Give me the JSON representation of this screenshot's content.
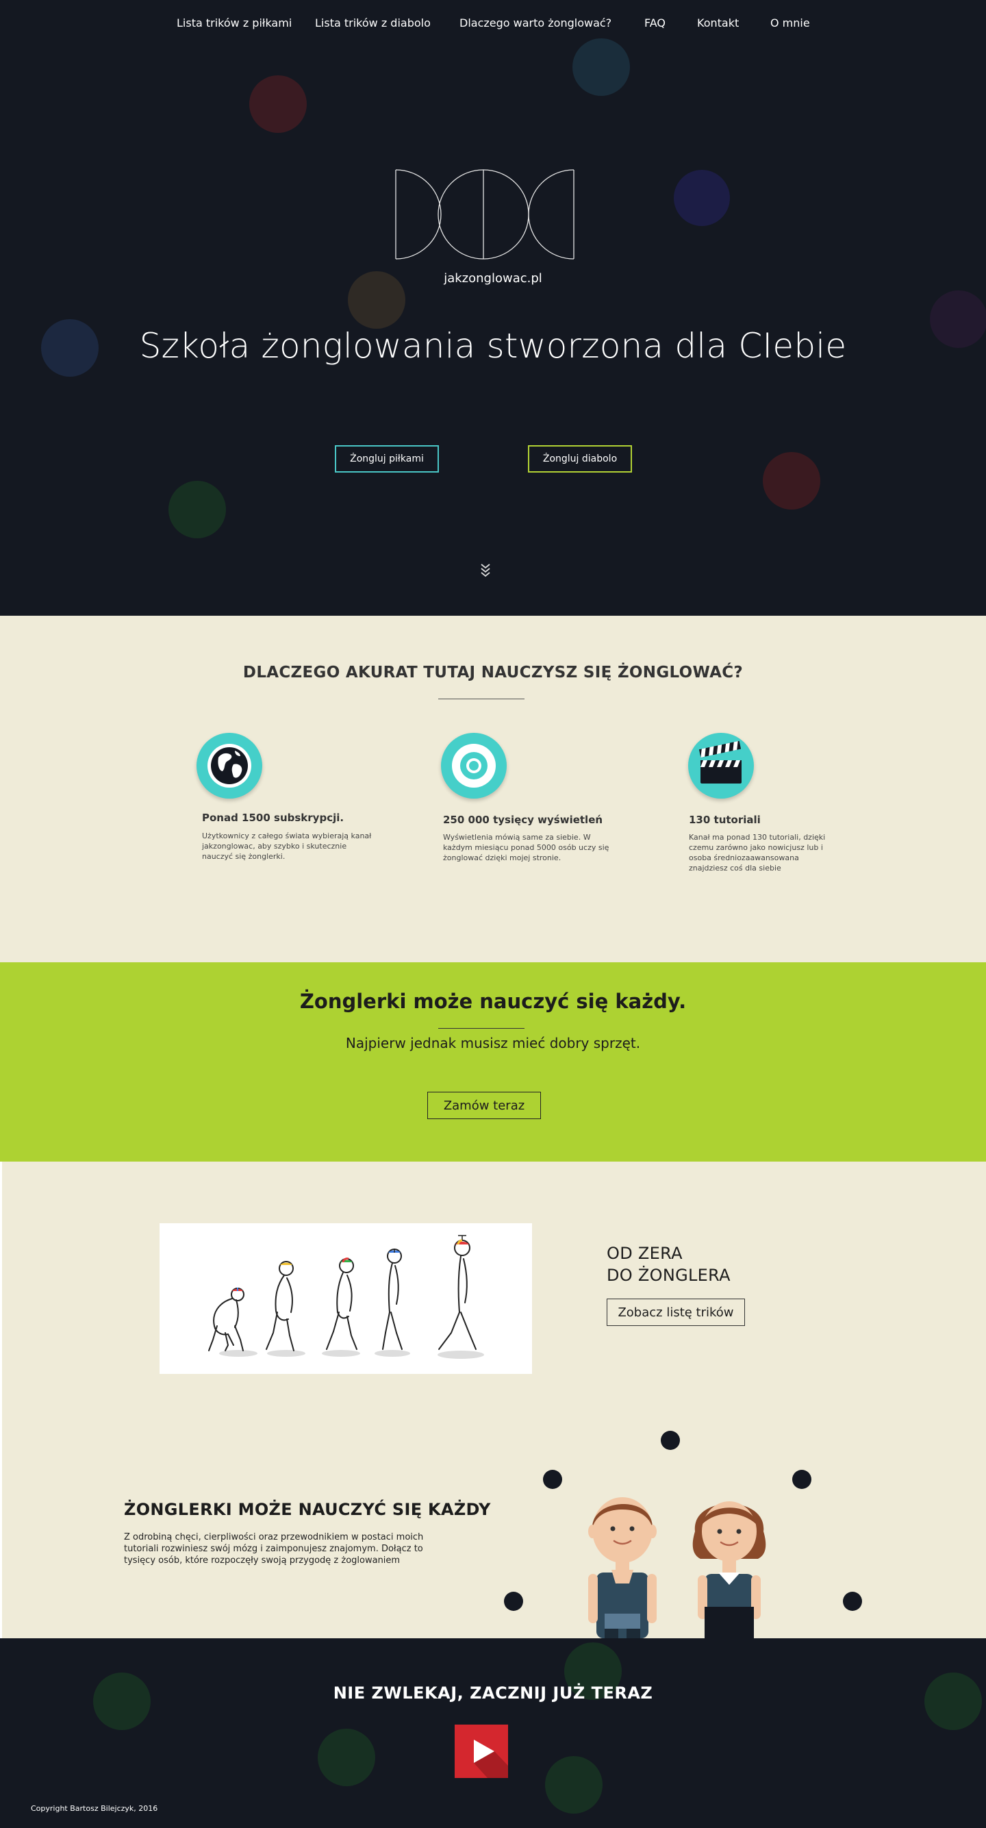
{
  "nav": {
    "items": [
      {
        "label": "Lista trików z piłkami"
      },
      {
        "label": "Lista trików z diabolo"
      },
      {
        "label": "Dlaczego warto żonglować?"
      },
      {
        "label": "FAQ"
      },
      {
        "label": "Kontakt"
      },
      {
        "label": "O mnie"
      }
    ]
  },
  "hero": {
    "site_name": "jakzonglowac.pl",
    "title": "Szkoła żonglowania stworzona dla CIebie",
    "buttons": {
      "balls": "Żongluj piłkami",
      "diabolo": "Żongluj diabolo"
    },
    "scroll_icon": "chevron-double-down-icon"
  },
  "why": {
    "title": "DLACZEGO AKURAT TUTAJ NAUCZYSZ SIĘ ŻONGLOWAĆ?",
    "features": [
      {
        "icon": "globe-icon",
        "title": "Ponad 1500 subskrypcji.",
        "desc": "Użytkownicy z całego świata wybierają kanał jakzonglowac, aby szybko i skutecznie nauczyć się żonglerki."
      },
      {
        "icon": "eye-icon",
        "title": "250 000 tysięcy wyświetleń",
        "desc": "Wyświetlenia mówią same za siebie. W każdym miesiącu ponad 5000 osób uczy się żonglować dzięki mojej stronie."
      },
      {
        "icon": "clapperboard-icon",
        "title": "130 tutoriali",
        "desc": "Kanał ma ponad 130 tutoriali, dzięki czemu zarówno jako nowicjusz lub i osoba średniozaawansowana znajdziesz coś dla siebie"
      }
    ],
    "accent": "#45cfc9"
  },
  "cta": {
    "title": "Żonglerki może nauczyć się każdy.",
    "subtitle": "Najpierw jednak musisz mieć dobry sprzęt.",
    "button": "Zamów teraz",
    "bg": "#add232"
  },
  "zero": {
    "title_line1": "OD ZERA",
    "title_line2": "DO ŻONGLERA",
    "button": "Zobacz listę trików"
  },
  "anyone": {
    "title": "ŻONGLERKI MOŻE NAUCZYĆ SIĘ KAŻDY",
    "text": "Z odrobiną chęci, cierpliwości oraz przewodnikiem w postaci moich tutoriali rozwiniesz swój mózg i zaimponujesz znajomym. Dołącz to tysięcy osób, które rozpoczęły swoją przygodę z żoglowaniem"
  },
  "footer": {
    "title": "NIE ZWLEKAJ, ZACZNIJ JUŻ TERAZ",
    "play_icon": "youtube-play-icon",
    "copyright": "Copyright Bartosz Bilejczyk, 2016"
  },
  "colors": {
    "dark_bg": "#141821",
    "beige_bg": "#efebd8",
    "teal": "#4ac6c6",
    "lime": "#b2d234",
    "red": "#d4272e"
  }
}
